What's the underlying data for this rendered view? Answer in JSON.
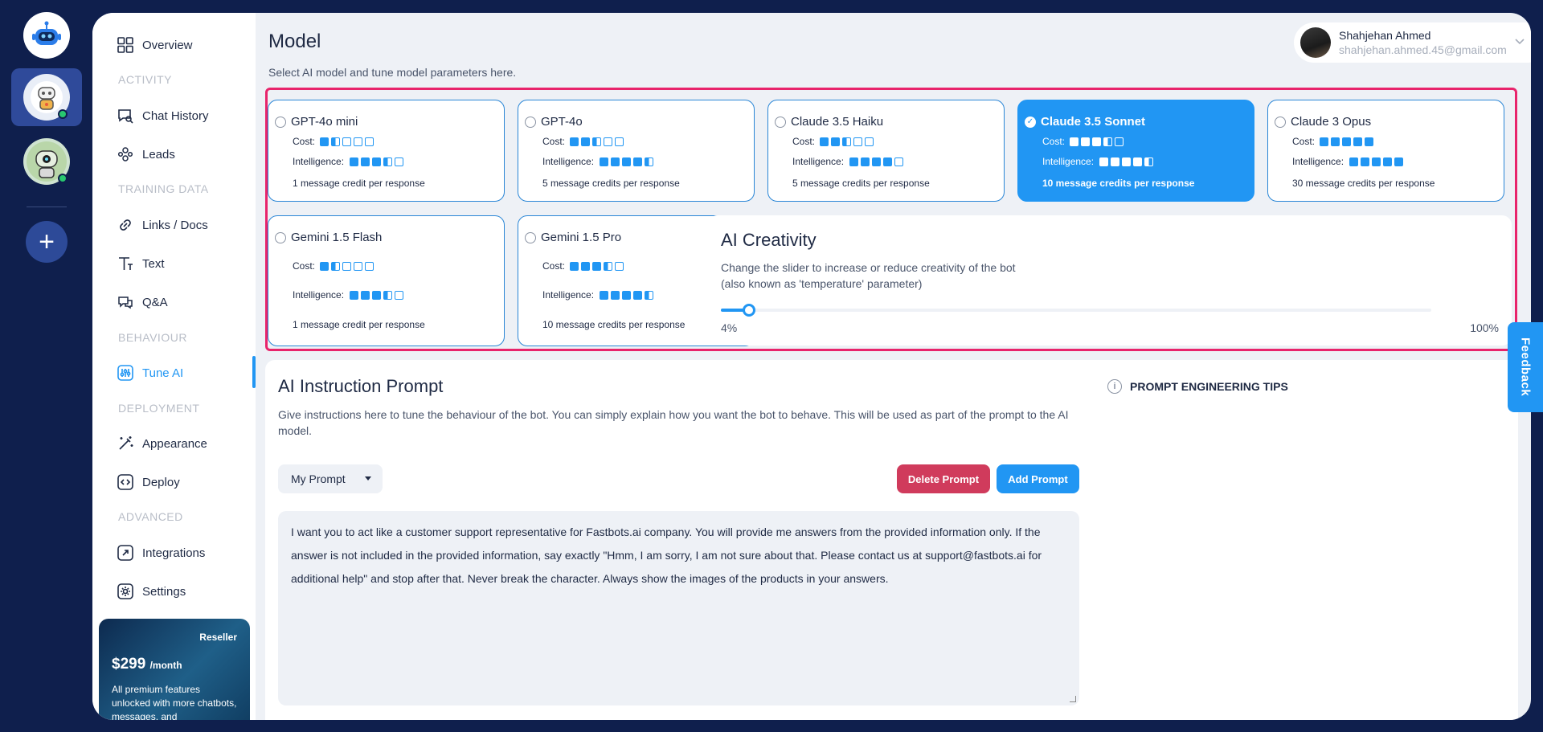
{
  "page": {
    "title": "Model",
    "subtitle": "Select AI model and tune model parameters here."
  },
  "user": {
    "name": "Shahjehan Ahmed",
    "email": "shahjehan.ahmed.45@gmail.com"
  },
  "sidebar": {
    "items": [
      {
        "label": "Overview",
        "icon": "grid-icon"
      },
      {
        "section": "ACTIVITY"
      },
      {
        "label": "Chat History",
        "icon": "chat-search-icon"
      },
      {
        "label": "Leads",
        "icon": "users-icon"
      },
      {
        "section": "TRAINING DATA"
      },
      {
        "label": "Links / Docs",
        "icon": "link-icon"
      },
      {
        "label": "Text",
        "icon": "text-icon"
      },
      {
        "label": "Q&A",
        "icon": "qa-icon"
      },
      {
        "section": "BEHAVIOUR"
      },
      {
        "label": "Tune AI",
        "icon": "sliders-icon",
        "active": true
      },
      {
        "section": "DEPLOYMENT"
      },
      {
        "label": "Appearance",
        "icon": "magic-wand-icon"
      },
      {
        "label": "Deploy",
        "icon": "code-icon"
      },
      {
        "section": "ADVANCED"
      },
      {
        "label": "Integrations",
        "icon": "integrations-icon"
      },
      {
        "label": "Settings",
        "icon": "gear-icon"
      }
    ],
    "promo": {
      "tag": "Reseller",
      "price": "$299",
      "period": "/month",
      "desc": "All premium features unlocked with more chatbots, messages, and"
    }
  },
  "models": {
    "cost_label": "Cost:",
    "intelligence_label": "Intelligence:",
    "cards": [
      {
        "name": "GPT-4o mini",
        "cost": 1.5,
        "intelligence": 3.5,
        "credits": "1 message credit per response",
        "selected": false
      },
      {
        "name": "GPT-4o",
        "cost": 2.5,
        "intelligence": 4.5,
        "credits": "5 message credits per response",
        "selected": false
      },
      {
        "name": "Claude 3.5 Haiku",
        "cost": 2.5,
        "intelligence": 4,
        "credits": "5 message credits per response",
        "selected": false
      },
      {
        "name": "Claude 3.5 Sonnet",
        "cost": 3.5,
        "intelligence": 4.5,
        "credits": "10 message credits per response",
        "selected": true
      },
      {
        "name": "Claude 3 Opus",
        "cost": 5,
        "intelligence": 5,
        "credits": "30 message credits per response",
        "selected": false
      },
      {
        "name": "Gemini 1.5 Flash",
        "cost": 1.5,
        "intelligence": 3.5,
        "credits": "1 message credit per response",
        "selected": false
      },
      {
        "name": "Gemini 1.5 Pro",
        "cost": 3.5,
        "intelligence": 4.5,
        "credits": "10 message credits per response",
        "selected": false
      }
    ]
  },
  "creativity": {
    "title": "AI Creativity",
    "desc_line1": "Change the slider to increase or reduce creativity of the bot",
    "desc_line2": "(also known as 'temperature' parameter)",
    "value": 4,
    "min_label": "4%",
    "max_label": "100%"
  },
  "prompt": {
    "title": "AI Instruction Prompt",
    "desc": "Give instructions here to tune the behaviour of the bot. You can simply explain how you want the bot to behave. This will be used as part of the prompt to the AI model.",
    "selected": "My Prompt",
    "delete_label": "Delete Prompt",
    "add_label": "Add Prompt",
    "text": "I want you to act like a customer support representative for Fastbots.ai company. You will provide me answers from the provided information only. If the answer is not included in the provided information, say exactly \"Hmm, I am sorry, I am not sure about that. Please contact us at support@fastbots.ai for additional help\" and stop after that. Never break the character. Always show the images of the products in your answers.",
    "tips_label": "PROMPT ENGINEERING TIPS"
  },
  "feedback_label": "Feedback",
  "colors": {
    "accent": "#2196f3",
    "danger": "#d03b5c",
    "highlight": "#e8246b",
    "rail": "#0f1f4d"
  }
}
